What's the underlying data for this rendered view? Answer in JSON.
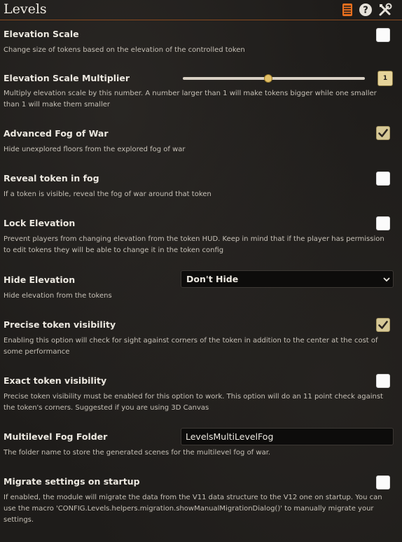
{
  "header": {
    "title": "Levels",
    "icons": [
      "book-icon",
      "help-icon",
      "tools-icon"
    ]
  },
  "colors": {
    "accent": "#e86f1e",
    "checked": "#d6c896"
  },
  "settings": {
    "elevation_scale": {
      "label": "Elevation Scale",
      "hint": "Change size of tokens based on the elevation of the controlled token",
      "checked": false
    },
    "elevation_scale_multiplier": {
      "label": "Elevation Scale Multiplier",
      "hint": "Multiply elevation scale by this number. A number larger than 1 will make tokens bigger while one smaller than 1 will make them smaller",
      "value": "1",
      "slider_fraction": 0.47
    },
    "advanced_fog": {
      "label": "Advanced Fog of War",
      "hint": "Hide unexplored floors from the explored fog of war",
      "checked": true
    },
    "reveal_token_fog": {
      "label": "Reveal token in fog",
      "hint": "If a token is visible, reveal the fog of war around that token",
      "checked": false
    },
    "lock_elevation": {
      "label": "Lock Elevation",
      "hint": "Prevent players from changing elevation from the token HUD. Keep in mind that if the player has permission to edit tokens they will be able to change it in the token config",
      "checked": false
    },
    "hide_elevation": {
      "label": "Hide Elevation",
      "hint": "Hide elevation from the tokens",
      "selected": "Don't Hide"
    },
    "precise_visibility": {
      "label": "Precise token visibility",
      "hint": "Enabling this option will check for sight against corners of the token in addition to the center at the cost of some performance",
      "checked": true
    },
    "exact_visibility": {
      "label": "Exact token visibility",
      "hint": "Precise token visibility must be enabled for this option to work. This option will do an 11 point check against the token's corners. Suggested if you are using 3D Canvas",
      "checked": false
    },
    "multilevel_fog_folder": {
      "label": "Multilevel Fog Folder",
      "hint": "The folder name to store the generated scenes for the multilevel fog of war.",
      "value": "LevelsMultiLevelFog"
    },
    "migrate_settings": {
      "label": "Migrate settings on startup",
      "hint": "If enabled, the module will migrate the data from the V11 data structure to the V12 one on startup. You can use the macro 'CONFIG.Levels.helpers.migration.showManualMigrationDialog()' to manually migrate your settings.",
      "checked": false
    }
  }
}
